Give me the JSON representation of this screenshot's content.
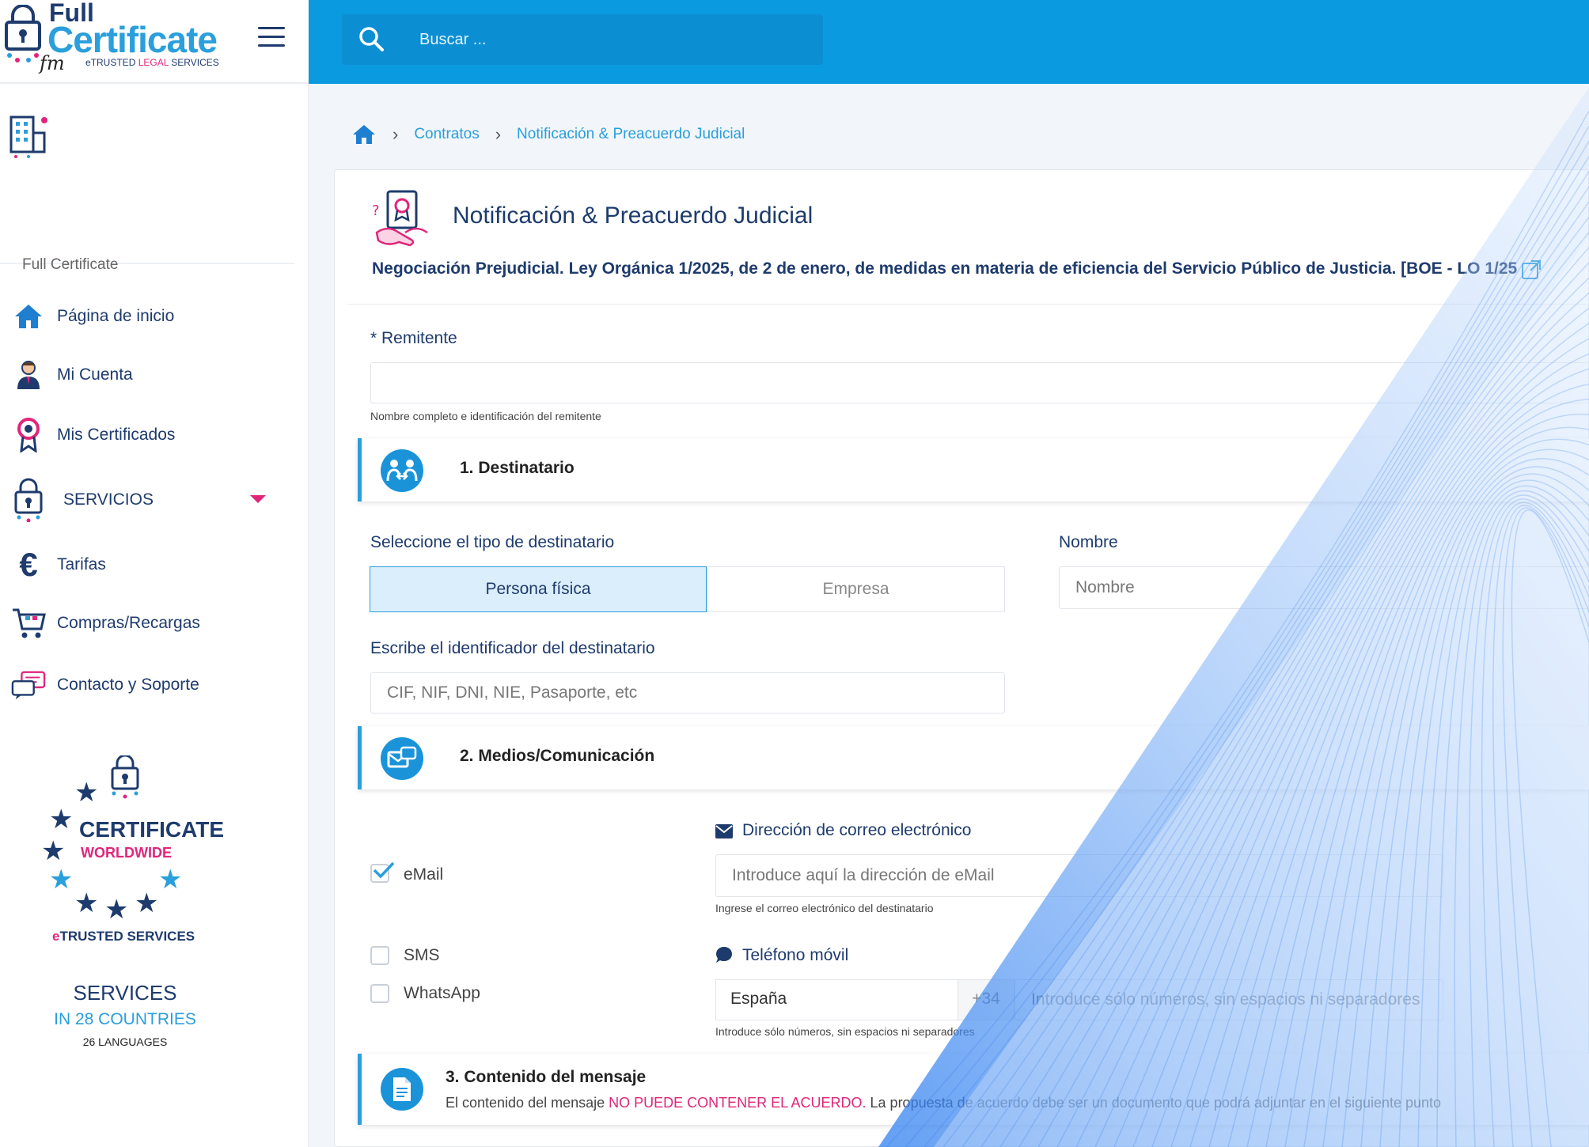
{
  "logo": {
    "line1": "Full",
    "line2": "Certificate",
    "sub_prefix": "e",
    "sub_trusted": "TRUSTED ",
    "sub_legal": "LEGAL",
    "sub_services": " SERVICES"
  },
  "org": {
    "name": "Full Certificate"
  },
  "search": {
    "placeholder": "Buscar ..."
  },
  "nav": {
    "items": [
      {
        "label": "Página de inicio",
        "icon": "home-icon"
      },
      {
        "label": "Mi Cuenta",
        "icon": "user-icon"
      },
      {
        "label": "Mis Certificados",
        "icon": "award-icon"
      },
      {
        "label": "SERVICIOS",
        "icon": "services-lock-icon"
      },
      {
        "label": "Tarifas",
        "icon": "euro-icon"
      },
      {
        "label": "Compras/Recargas",
        "icon": "cart-icon"
      },
      {
        "label": "Contacto y Soporte",
        "icon": "support-chat-icon"
      }
    ]
  },
  "badge": {
    "certificate": "CERTIFICATE",
    "worldwide": "WORLDWIDE",
    "e": "e",
    "trusted": "TRUSTED SERVICES",
    "services": "SERVICES",
    "countries": "IN 28 COUNTRIES",
    "languages": "26 LANGUAGES"
  },
  "breadcrumb": {
    "items": [
      "Contratos",
      "Notificación & Preacuerdo Judicial"
    ]
  },
  "page": {
    "title": "Notificación & Preacuerdo Judicial",
    "subtitle": "Negociación Prejudicial. Ley Orgánica 1/2025, de 2 de enero, de medidas en materia de eficiencia del Servicio Público de Justicia. [BOE - LO 1/25"
  },
  "form": {
    "remitente_label": "* Remitente",
    "remitente_value": "",
    "remitente_help": "Nombre completo e identificación del remitente",
    "section1": "1. Destinatario",
    "tipo_label": "Seleccione el tipo de destinatario",
    "tipo_options": [
      "Persona física",
      "Empresa"
    ],
    "tipo_selected": "Persona física",
    "nombre_label": "Nombre",
    "nombre_placeholder": "Nombre",
    "id_label": "Escribe el identificador del destinatario",
    "id_placeholder": "CIF, NIF, DNI, NIE, Pasaporte, etc",
    "section2": "2. Medios/Comunicación",
    "channels": [
      {
        "label": "eMail",
        "checked": true
      },
      {
        "label": "SMS",
        "checked": false
      },
      {
        "label": "WhatsApp",
        "checked": false
      }
    ],
    "email_label": "Dirección de correo electrónico",
    "email_placeholder": "Introduce aquí la dirección de eMail",
    "email_help": "Ingrese el correo electrónico del destinatario",
    "phone_label": "Teléfono móvil",
    "country": "España",
    "dial_code": "+34",
    "phone_placeholder": "Introduce sólo números, sin espacios ni separadores",
    "phone_help": "Introduce sólo números, sin espacios ni separadores",
    "section3": "3. Contenido del mensaje",
    "section3_desc_prefix": "El contenido del mensaje ",
    "section3_desc_warn": "NO PUEDE CONTENER EL ACUERDO.",
    "section3_desc_suffix": " La propuesta de acuerdo debe ser un documento que podrá adjuntar en el siguiente punto"
  },
  "colors": {
    "topbar": "#0a9ae0",
    "navy": "#1e3b6d",
    "accent": "#2a9fdc",
    "pink": "#e0267a"
  }
}
